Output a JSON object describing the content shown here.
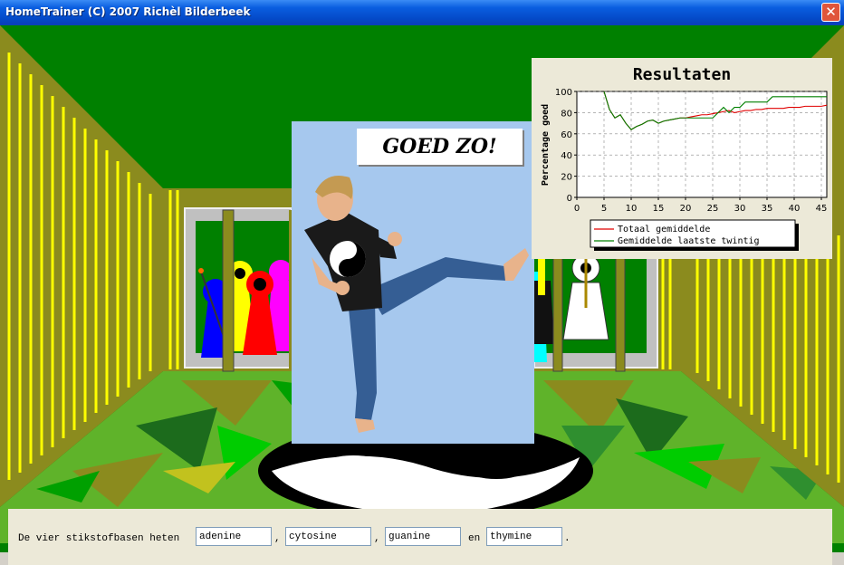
{
  "window": {
    "title": "HomeTrainer (C) 2007 Richèl Bilderbeek",
    "close_glyph": "✕"
  },
  "feedback": {
    "message": "GOED ZO!"
  },
  "results": {
    "title": "Resultaten"
  },
  "chart_data": {
    "type": "line",
    "title": "Resultaten",
    "xlabel": "",
    "ylabel": "Percentage goed",
    "xlim": [
      0,
      46
    ],
    "ylim": [
      0,
      100
    ],
    "xticks": [
      0,
      5,
      10,
      15,
      20,
      25,
      30,
      35,
      40,
      45
    ],
    "yticks": [
      0,
      20,
      40,
      60,
      80,
      100
    ],
    "grid": true,
    "legend": "bottom",
    "series": [
      {
        "name": "Totaal gemiddelde",
        "color": "#e00000",
        "x": [
          5,
          6,
          7,
          8,
          9,
          10,
          11,
          12,
          13,
          14,
          15,
          16,
          17,
          18,
          19,
          20,
          21,
          22,
          23,
          24,
          25,
          26,
          27,
          28,
          29,
          30,
          31,
          32,
          33,
          34,
          35,
          36,
          37,
          38,
          39,
          40,
          41,
          42,
          43,
          44,
          45,
          46
        ],
        "values": [
          100,
          83,
          75,
          78,
          70,
          64,
          67,
          69,
          72,
          73,
          70,
          72,
          73,
          74,
          75,
          75,
          76,
          77,
          78,
          78,
          79,
          80,
          81,
          82,
          80,
          81,
          82,
          82,
          83,
          83,
          84,
          84,
          84,
          84,
          85,
          85,
          85,
          86,
          86,
          86,
          86,
          87
        ]
      },
      {
        "name": "Gemiddelde laatste twintig",
        "color": "#008000",
        "x": [
          5,
          6,
          7,
          8,
          9,
          10,
          11,
          12,
          13,
          14,
          15,
          16,
          17,
          18,
          19,
          20,
          21,
          22,
          23,
          24,
          25,
          26,
          27,
          28,
          29,
          30,
          31,
          32,
          33,
          34,
          35,
          36,
          37,
          38,
          39,
          40,
          41,
          42,
          43,
          44,
          45,
          46
        ],
        "values": [
          100,
          83,
          75,
          78,
          70,
          64,
          67,
          69,
          72,
          73,
          70,
          72,
          73,
          74,
          75,
          75,
          75,
          75,
          75,
          75,
          75,
          80,
          85,
          80,
          85,
          85,
          90,
          90,
          90,
          90,
          90,
          95,
          95,
          95,
          95,
          95,
          95,
          95,
          95,
          95,
          95,
          95
        ]
      }
    ]
  },
  "question": {
    "prefix": "De vier stikstofbasen heten",
    "sep1": ",",
    "sep2": ",",
    "sep3": "en",
    "suffix": ".",
    "answers": [
      "adenine",
      "cytosine",
      "guanine",
      "thymine"
    ]
  }
}
